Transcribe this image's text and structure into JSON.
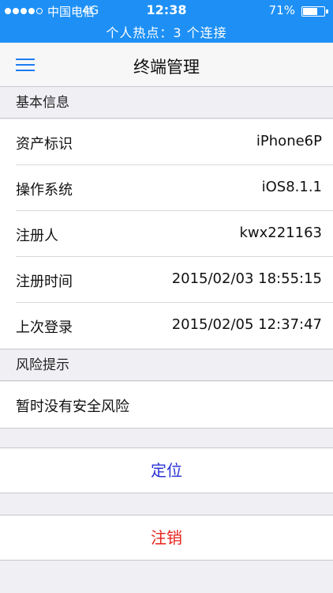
{
  "status_bar": {
    "carrier": "中国电信",
    "network": "4G",
    "time": "12:38",
    "battery_percent": "71%",
    "battery_level": 0.71,
    "signal_bars_filled": 4,
    "hotspot_text": "个人热点：3 个连接",
    "background_color": "#1e90f5"
  },
  "navbar": {
    "title": "终端管理",
    "menu_icon": "hamburger-menu-icon"
  },
  "basic_info": {
    "header": "基本信息",
    "rows": [
      {
        "label": "资产标识",
        "value": "iPhone6P"
      },
      {
        "label": "操作系统",
        "value": "iOS8.1.1"
      },
      {
        "label": "注册人",
        "value": "kwx221163"
      },
      {
        "label": "注册时间",
        "value": "2015/02/03 18:55:15"
      },
      {
        "label": "上次登录",
        "value": "2015/02/05 12:37:47"
      }
    ]
  },
  "risk": {
    "header": "风险提示",
    "message": "暂时没有安全风险"
  },
  "actions": {
    "locate_label": "定位",
    "locate_color": "#2a34d6",
    "logout_label": "注销",
    "logout_color": "#e8211c"
  }
}
